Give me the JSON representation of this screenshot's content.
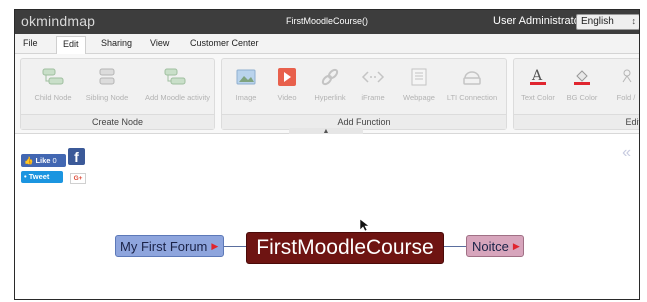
{
  "app": {
    "logo": "okmindmap",
    "document_title": "FirstMoodleCourse()",
    "user": "User Administrator",
    "language": "English"
  },
  "menu": {
    "tabs": [
      "File",
      "Edit",
      "Sharing",
      "View",
      "Customer Center"
    ],
    "active_tab": "Edit"
  },
  "ribbon": {
    "create_node": {
      "label": "Create Node",
      "tools": [
        "Child Node",
        "Sibling Node",
        "Add Moodle activity"
      ]
    },
    "add_function": {
      "label": "Add Function",
      "tools": [
        "Image",
        "Video",
        "Hyperlink",
        "iFrame",
        "Webpage",
        "LTI Connection"
      ]
    },
    "edit_node": {
      "label": "Edit N",
      "tools": [
        "Text Color",
        "BG Color",
        "Fold /"
      ]
    }
  },
  "social": {
    "like_label": "Like",
    "like_count": "0",
    "facebook_glyph": "f",
    "tweet_label": "Tweet",
    "gplus_label": "G+"
  },
  "mindmap": {
    "root": "FirstMoodleCourse",
    "left_child": "My First Forum",
    "right_child": "Noitce",
    "colors": {
      "root_bg": "#6e1412",
      "left_bg": "#8ea5dd",
      "right_bg": "#d7a5bc",
      "folded_arrow": "#e0252f"
    }
  },
  "icons": {
    "panel_toggle": "double-chevron-left-icon",
    "cursor": "mouse-pointer-icon",
    "fold_indicator": "red-triangle-right-icon"
  }
}
